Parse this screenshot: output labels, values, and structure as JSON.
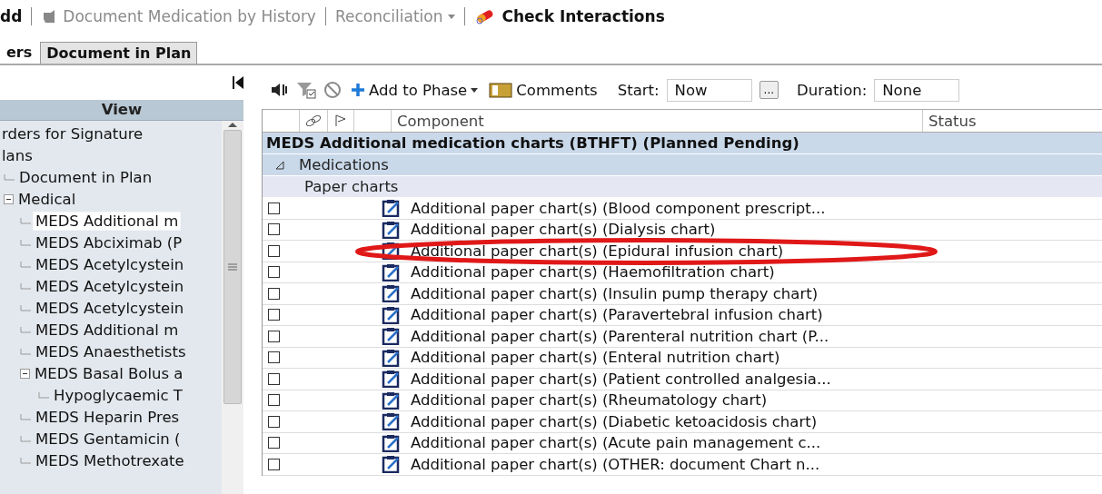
{
  "toolbar": {
    "items": [
      {
        "kind": "text",
        "label": "dd",
        "disabled": false
      },
      {
        "kind": "history",
        "label": "Document Medication by History",
        "disabled": true
      },
      {
        "kind": "dropdown",
        "label": "Reconciliation",
        "disabled": true
      },
      {
        "kind": "interactions",
        "label": "Check Interactions",
        "disabled": false
      }
    ]
  },
  "tabs": [
    {
      "label": "ers",
      "selected": true
    },
    {
      "label": "Document in Plan",
      "selected": false
    }
  ],
  "sidebar": {
    "header": "View",
    "items": [
      {
        "label": "rders for Signature",
        "selected": false
      },
      {
        "label": "lans",
        "selected": false,
        "children": [
          {
            "label": "Document in Plan",
            "selected": false
          },
          {
            "label": "Medical",
            "selected": false,
            "expanded": true,
            "children": [
              {
                "label": "MEDS Additional m",
                "selected": true
              },
              {
                "label": "MEDS Abciximab (P",
                "selected": false
              },
              {
                "label": "MEDS Acetylcystein",
                "selected": false
              },
              {
                "label": "MEDS Acetylcystein",
                "selected": false
              },
              {
                "label": "MEDS Acetylcystein",
                "selected": false
              },
              {
                "label": "MEDS Additional m",
                "selected": false
              },
              {
                "label": "MEDS Anaesthetists",
                "selected": false
              },
              {
                "label": "MEDS Basal  Bolus a",
                "selected": false,
                "expanded": true,
                "children": [
                  {
                    "label": "Hypoglycaemic T",
                    "selected": false
                  }
                ]
              },
              {
                "label": "MEDS Heparin Pres",
                "selected": false
              },
              {
                "label": "MEDS Gentamicin (",
                "selected": false
              },
              {
                "label": "MEDS Methotrexate",
                "selected": false
              }
            ]
          }
        ]
      }
    ]
  },
  "order_toolbar": {
    "add_to_phase": "Add to Phase",
    "comments": "Comments",
    "start_label": "Start:",
    "start_value": "Now",
    "browse": "...",
    "duration_label": "Duration:",
    "duration_value": "None"
  },
  "table": {
    "columns": [
      "Component",
      "Status"
    ],
    "plan_row": "MEDS Additional medication charts (BTHFT) (Planned Pending)",
    "category": {
      "label": "Medications",
      "expanded": true
    },
    "subcategory": "Paper charts",
    "rows": [
      {
        "component": "Additional paper chart(s) (Blood component prescript...",
        "checked": false,
        "highlighted": false
      },
      {
        "component": "Additional paper chart(s) (Dialysis chart)",
        "checked": false,
        "highlighted": false
      },
      {
        "component": "Additional paper chart(s) (Epidural infusion chart)",
        "checked": false,
        "highlighted": true
      },
      {
        "component": "Additional paper chart(s) (Haemofiltration chart)",
        "checked": false,
        "highlighted": false
      },
      {
        "component": "Additional paper chart(s) (Insulin pump therapy chart)",
        "checked": false,
        "highlighted": false
      },
      {
        "component": "Additional paper chart(s) (Paravertebral infusion chart)",
        "checked": false,
        "highlighted": false
      },
      {
        "component": "Additional paper chart(s) (Parenteral nutrition chart (P...",
        "checked": false,
        "highlighted": false
      },
      {
        "component": "Additional paper chart(s) (Enteral nutrition chart)",
        "checked": false,
        "highlighted": false
      },
      {
        "component": "Additional paper chart(s) (Patient controlled analgesia...",
        "checked": false,
        "highlighted": false
      },
      {
        "component": "Additional paper chart(s) (Rheumatology chart)",
        "checked": false,
        "highlighted": false
      },
      {
        "component": "Additional paper chart(s) (Diabetic ketoacidosis chart)",
        "checked": false,
        "highlighted": false
      },
      {
        "component": "Additional paper chart(s) (Acute pain management c...",
        "checked": false,
        "highlighted": false
      },
      {
        "component": "Additional paper chart(s) (OTHER: document Chart n...",
        "checked": false,
        "highlighted": false
      }
    ]
  }
}
